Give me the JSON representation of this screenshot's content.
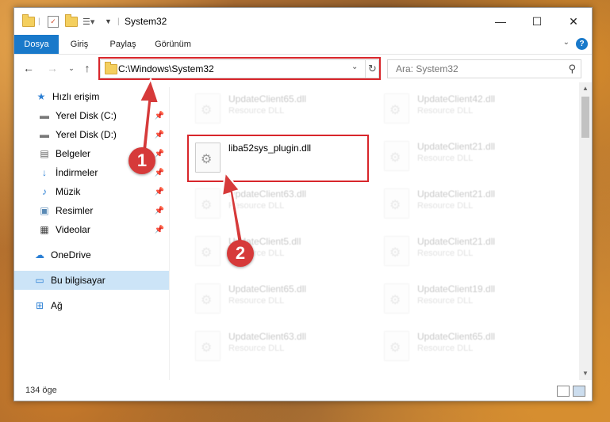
{
  "window": {
    "title": "System32",
    "controls": {
      "minimize": "—",
      "maximize": "☐",
      "close": "✕"
    }
  },
  "ribbon": {
    "tabs": [
      "Dosya",
      "Giriş",
      "Paylaş",
      "Görünüm"
    ],
    "help": "?"
  },
  "address": {
    "path": "C:\\Windows\\System32",
    "search_placeholder": "Ara: System32"
  },
  "sidebar": {
    "items": [
      {
        "label": "Hızlı erişim",
        "icon": "star-icon"
      },
      {
        "label": "Yerel Disk (C:)",
        "icon": "drive-icon"
      },
      {
        "label": "Yerel Disk (D:)",
        "icon": "drive-icon"
      },
      {
        "label": "Belgeler",
        "icon": "document-icon"
      },
      {
        "label": "İndirmeler",
        "icon": "download-icon"
      },
      {
        "label": "Müzik",
        "icon": "music-icon"
      },
      {
        "label": "Resimler",
        "icon": "picture-icon"
      },
      {
        "label": "Videolar",
        "icon": "video-icon"
      },
      {
        "label": "OneDrive",
        "icon": "cloud-icon"
      },
      {
        "label": "Bu bilgisayar",
        "icon": "computer-icon"
      },
      {
        "label": "Ağ",
        "icon": "network-icon"
      }
    ]
  },
  "files": {
    "left": [
      {
        "name": "UpdateClient65.dll",
        "type": "Resource DLL"
      },
      {
        "name": "liba52sys_plugin.dll",
        "type": ""
      },
      {
        "name": "UpdateClient63.dll",
        "type": "Resource DLL"
      },
      {
        "name": "UpdateClient5.dll",
        "type": "Resource DLL"
      },
      {
        "name": "UpdateClient65.dll",
        "type": "Resource DLL"
      },
      {
        "name": "UpdateClient63.dll",
        "type": "Resource DLL"
      }
    ],
    "right": [
      {
        "name": "UpdateClient42.dll",
        "type": "Resource DLL"
      },
      {
        "name": "UpdateClient21.dll",
        "type": "Resource DLL"
      },
      {
        "name": "UpdateClient21.dll",
        "type": "Resource DLL"
      },
      {
        "name": "UpdateClient21.dll",
        "type": "Resource DLL"
      },
      {
        "name": "UpdateClient19.dll",
        "type": "Resource DLL"
      },
      {
        "name": "UpdateClient65.dll",
        "type": "Resource DLL"
      }
    ]
  },
  "status": {
    "count": "134 öge"
  },
  "callouts": [
    "1",
    "2"
  ],
  "colors": {
    "accent": "#1979ca",
    "highlight": "#d8262b",
    "selected": "#cce4f7"
  }
}
